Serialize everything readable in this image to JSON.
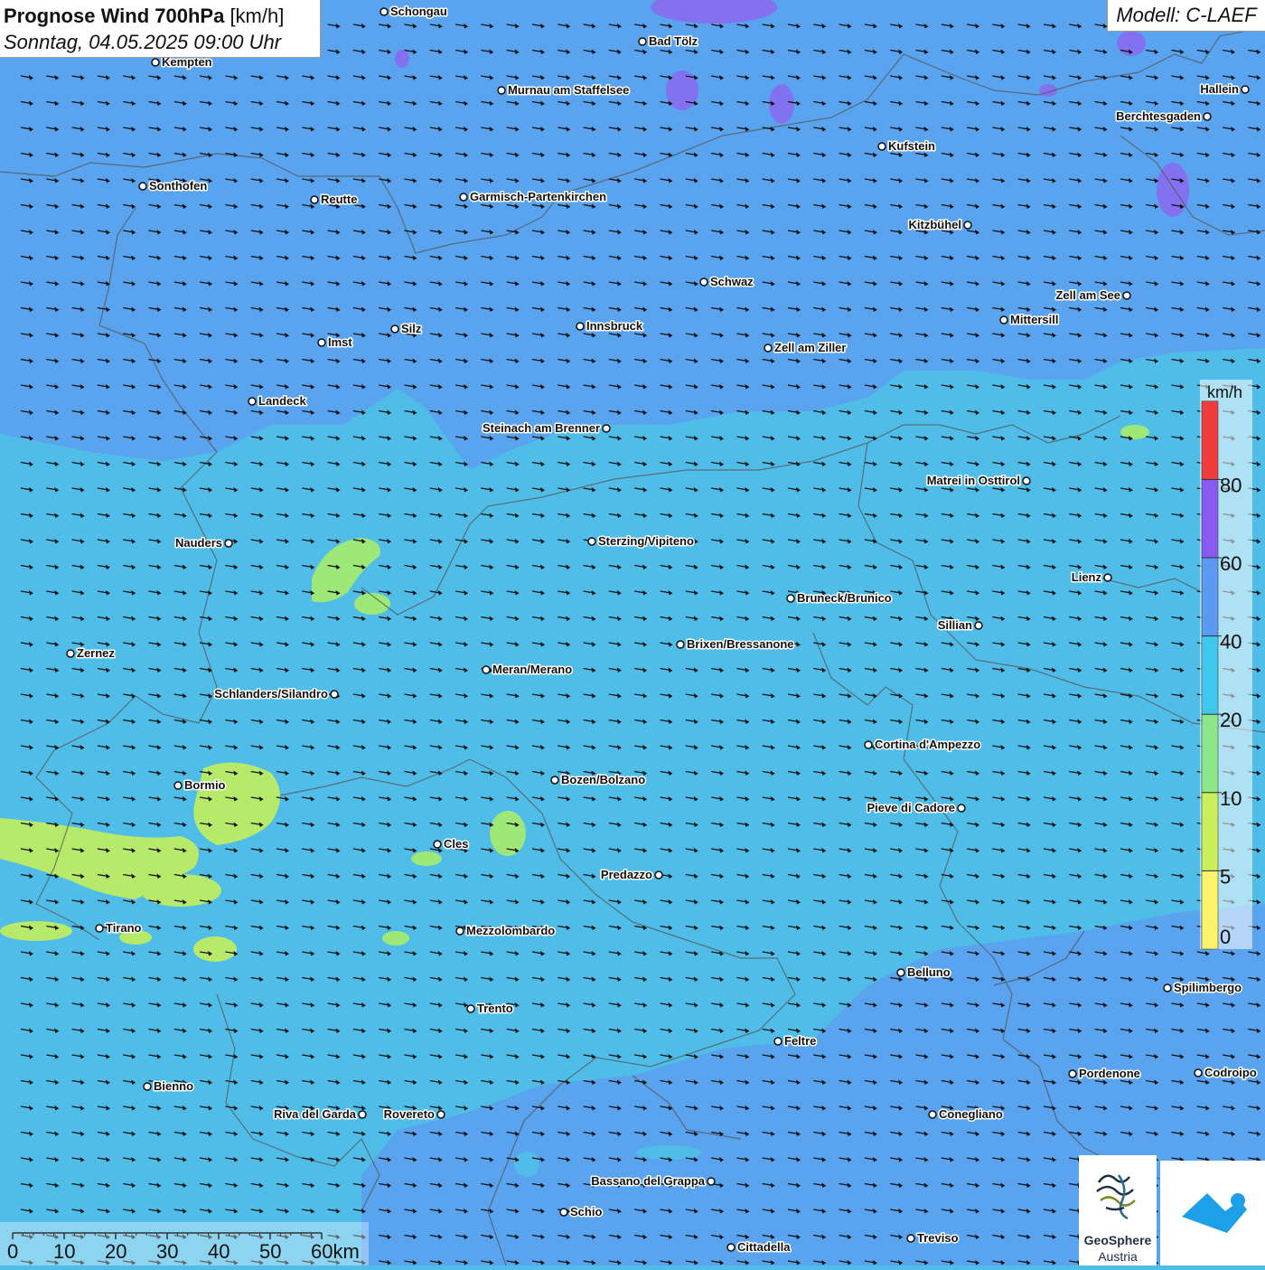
{
  "title": {
    "main": "Prognose Wind 700hPa",
    "unit": "[km/h]",
    "datetime": "Sonntag, 04.05.2025 09:00 Uhr"
  },
  "model": "Modell: C-LAEF",
  "legend": {
    "unit": "km/h",
    "bins": [
      {
        "label": "0",
        "color": "#fbf46a"
      },
      {
        "label": "5",
        "color": "#c9f05a"
      },
      {
        "label": "10",
        "color": "#8ae88a"
      },
      {
        "label": "20",
        "color": "#3fc7ee"
      },
      {
        "label": "40",
        "color": "#5a9af0"
      },
      {
        "label": "60",
        "color": "#8a5af0"
      },
      {
        "label": "80",
        "color": "#f03c3c"
      }
    ]
  },
  "scale_bar": {
    "ticks": [
      "0",
      "10",
      "20",
      "30",
      "40",
      "50",
      "60km"
    ]
  },
  "towns": [
    {
      "name": "Schongau"
    },
    {
      "name": "Bad Tölz"
    },
    {
      "name": "Kempten"
    },
    {
      "name": "Murnau am Staffelsee"
    },
    {
      "name": "Hallein"
    },
    {
      "name": "Berchtesgaden"
    },
    {
      "name": "Kufstein"
    },
    {
      "name": "Sonthofen"
    },
    {
      "name": "Reutte"
    },
    {
      "name": "Garmisch-Partenkirchen"
    },
    {
      "name": "Kitzbühel"
    },
    {
      "name": "Schwaz"
    },
    {
      "name": "Zell am See"
    },
    {
      "name": "Mittersill"
    },
    {
      "name": "Innsbruck"
    },
    {
      "name": "Silz"
    },
    {
      "name": "Imst"
    },
    {
      "name": "Zell am Ziller"
    },
    {
      "name": "Landeck"
    },
    {
      "name": "Steinach am Brenner"
    },
    {
      "name": "Matrei in Osttirol"
    },
    {
      "name": "Nauders"
    },
    {
      "name": "Sterzing/Vipiteno"
    },
    {
      "name": "Lienz"
    },
    {
      "name": "Bruneck/Brunico"
    },
    {
      "name": "Sillian"
    },
    {
      "name": "Brixen/Bressanone"
    },
    {
      "name": "Zernez"
    },
    {
      "name": "Meran/Merano"
    },
    {
      "name": "Schlanders/Silandro"
    },
    {
      "name": "Cortina d'Ampezzo"
    },
    {
      "name": "Bozen/Bolzano"
    },
    {
      "name": "Bormio"
    },
    {
      "name": "Pieve di Cadore"
    },
    {
      "name": "Cles"
    },
    {
      "name": "Predazzo"
    },
    {
      "name": "Tirano"
    },
    {
      "name": "Mezzolombardo"
    },
    {
      "name": "Belluno"
    },
    {
      "name": "Spilimbergo"
    },
    {
      "name": "Trento"
    },
    {
      "name": "Feltre"
    },
    {
      "name": "Pordenone"
    },
    {
      "name": "Codroipo"
    },
    {
      "name": "Bienno"
    },
    {
      "name": "Riva del Garda"
    },
    {
      "name": "Rovereto"
    },
    {
      "name": "Conegliano"
    },
    {
      "name": "Bassano del Grappa"
    },
    {
      "name": "Schio"
    },
    {
      "name": "Treviso"
    },
    {
      "name": "Cittadella"
    }
  ],
  "logo": {
    "line1": "GeoSphere",
    "line2": "Austria"
  }
}
